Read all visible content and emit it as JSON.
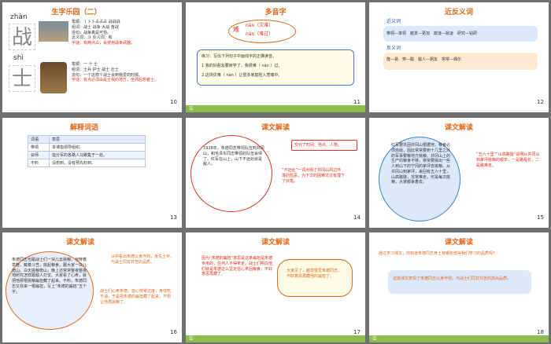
{
  "slides": [
    {
      "num": "10",
      "title": "生字乐园（二）",
      "pinyin1": "zhàn",
      "char1": "战",
      "pinyin2": "shì",
      "char2": "士",
      "lines1": [
        "笔顺：丨卜卜占占占 战战战",
        "组词：战士 战争 大战 奋战",
        "造句：战争真是可怕。",
        "近义词：斗 反义词：和",
        "字谜：有两点占，会使用战争武器。"
      ],
      "lines2": [
        "笔顺：一 十 士",
        "组词：士兵 护士 战士 壮士",
        "造句：一个这样个战士会到我爱的时候。",
        "字谜：有点必须由是士我的地方，坐而后想者士。"
      ]
    },
    {
      "num": "11",
      "title": "多音字",
      "char": "难",
      "reading1": "nàn（灾难）",
      "reading2": "nán（难过）",
      "task": "练习：写出下列句子中画线字的正确读音。",
      "s1": "1.我的好朋友要转学了，我很难（ nán ）过。",
      "s2": "2.这场灾难（ nàn ）让很多家庭陷入悲痛中。"
    },
    {
      "num": "12",
      "title": "近反义词",
      "syn_label": "近义词",
      "syn": "带领—率领　越发—更加　欺凌—掀凌　研究—钻研",
      "ant_label": "反义词",
      "ant": "隆—易　穿—脱　敌人—朋友　常常—偶尔"
    },
    {
      "num": "13",
      "title": "解释词语",
      "head": [
        "词语",
        "意思"
      ],
      "rows": [
        [
          "带领",
          "本课指领导组织。"
        ],
        [
          "会师",
          "指分军的各路人马聚集于一处。"
        ],
        [
          "不料",
          "没想到，没有预先料到。"
        ]
      ]
    },
    {
      "num": "14",
      "title": "课文解读",
      "body": "1928年，朱德同志带领队伍到井冈山，和毛泽东同志带领的队伍会师了。红军在山上，山下不远处就是敌人。",
      "note1": "交代了时间、地点、人物。",
      "note2": "“不远处”一词点明了井冈山周边环境的险恶，为下文的困难坑坑有埋下了伏笔。"
    },
    {
      "num": "15",
      "title": "课文解读",
      "body": "红军要巩固井冈山根据地，粮食必须自给，因此常常要到十几里之外的军事要粮地方挑粮。井冈山上的生产的粮食不够，常常要挑出一些人到山下的宁冈的茅坪去挑粮。从井冈山到茅坪，来回有五六十里，山高路陡，非常难走，可是每次挑粮，大家都争着去。",
      "note": "“五六十里”“山高路陡”说明从井冈山到茅坪挑粮的艰辛，一是路程长，二是路难走。"
    },
    {
      "num": "16",
      "title": "课文解读",
      "body": "朱德同志也跟战士们一块儿去挑粮。他穿着草鞋，戴着斗笠，挑起粮食，跟大家一块儿爬山。白天挑粮爬山，晚上还常常整夜整夜地研究怎样跟敌人打仗。大家看了心疼，就把他那根挑粮扁担藏了起来。不料，朱德同志又找来一根扁担，写上“朱德的扁担”五个字。",
      "note1": "从中看出朱德以身作则，身先士卒，与战士同甘共苦的品质。",
      "note2": "战士们心疼朱德，担心劳累过度，身体吃不消，于是把朱德的扁担藏了起来，不想让他再挑粮了。"
    },
    {
      "num": "17",
      "title": "课文解读",
      "body": "因为“朱德的扁担”意思是这条扁担是朱德专用的，任何人不得拿走。战士们明白他们就是朱德这么坚定信心拿回粮食，不好意思再藏了。",
      "note": "大家见了，越发敬爱朱德同志，不好意思再藏他的扁担了。"
    },
    {
      "num": "18",
      "title": "课文解读",
      "q": "通过学习课文，你知道朱德同志身上有哪些值得我们学习的品质吗？",
      "a": "这篇课文表现了朱德同志以身作则，与战士们同甘共苦的高尚品质。"
    }
  ],
  "colors": {
    "accent": "#8dbd4b",
    "title": "#e06a1b",
    "note_red": "#e0301e"
  }
}
